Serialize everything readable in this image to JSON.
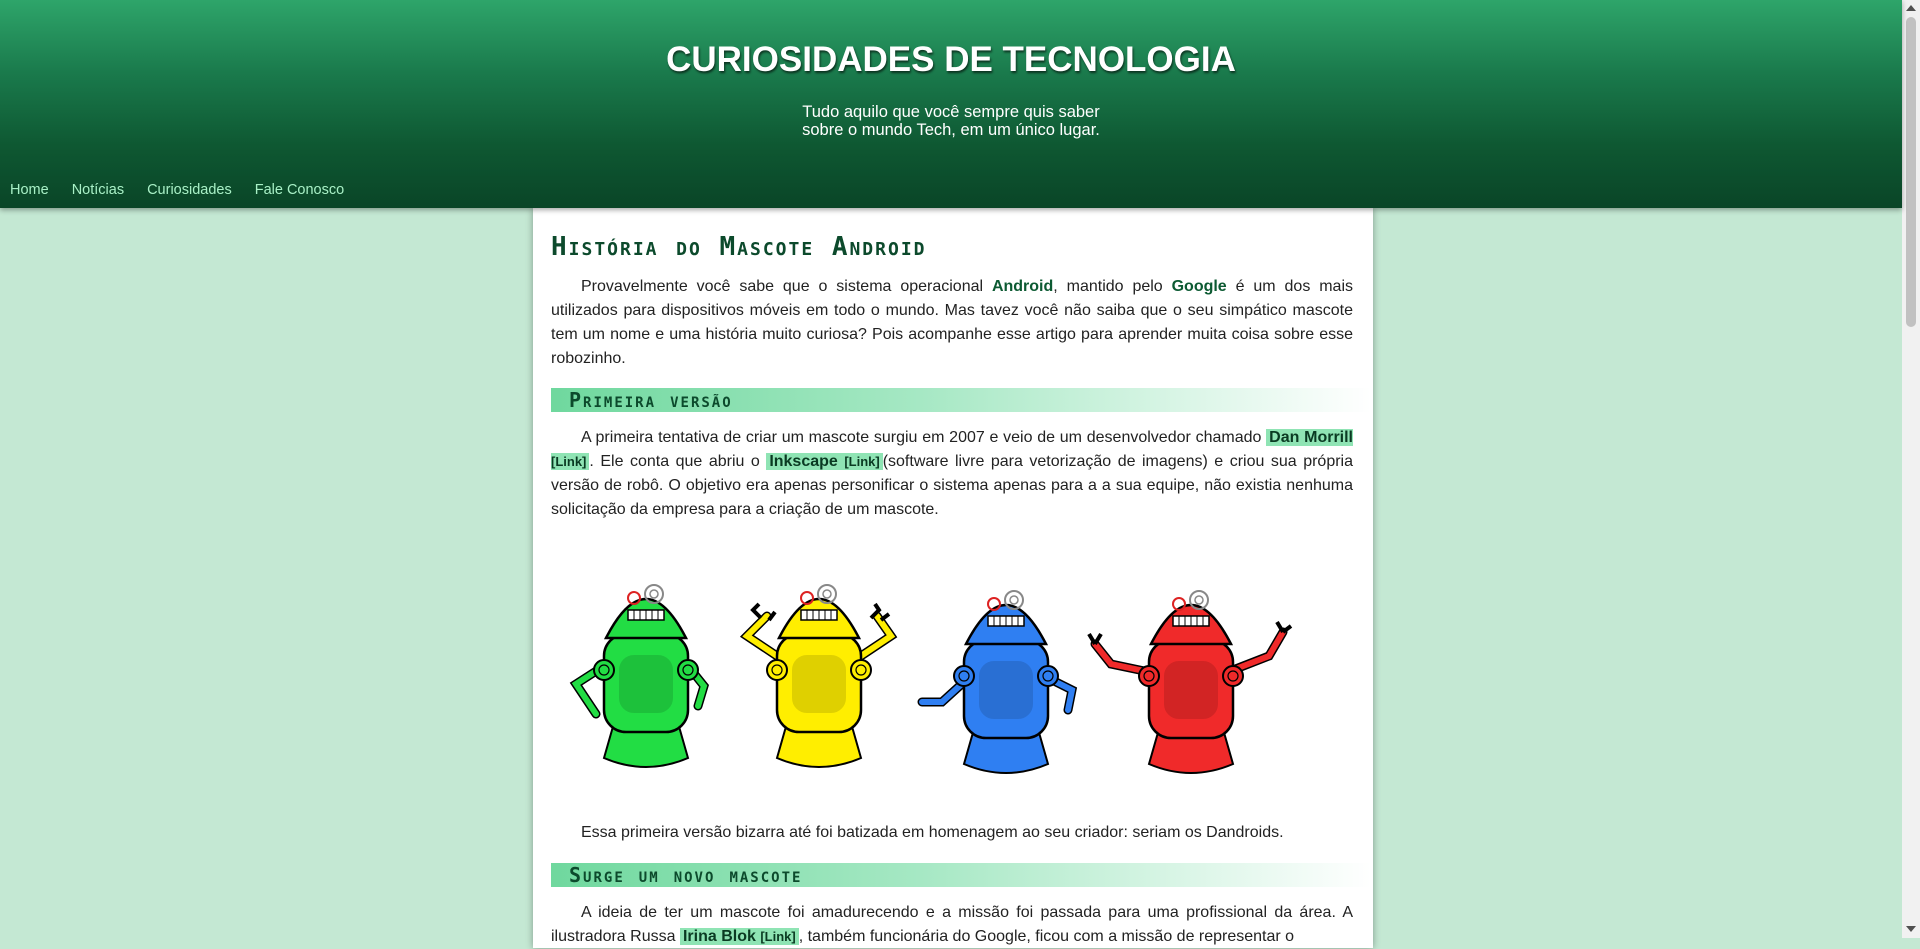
{
  "header": {
    "title": "CURIOSIDADES DE TECNOLOGIA",
    "subtitle_line1": "Tudo aquilo que você sempre quis saber",
    "subtitle_line2": "sobre o mundo Tech, em um único lugar."
  },
  "nav": {
    "items": [
      {
        "label": "Home"
      },
      {
        "label": "Notícias"
      },
      {
        "label": "Curiosidades"
      },
      {
        "label": "Fale Conosco"
      }
    ]
  },
  "article": {
    "title": "História do Mascote Android",
    "intro": {
      "t1": "Provavelmente você sabe que o sistema operacional ",
      "k1": "Android",
      "t2": ", mantido pelo ",
      "k2": "Google",
      "t3": " é um dos mais utilizados para dispositivos móveis em todo o mundo. Mas tavez você não saiba que o seu simpático mascote tem um nome e uma história muito curiosa? Pois acompanhe esse artigo para aprender muita coisa sobre esse robozinho."
    },
    "section1": {
      "heading": "Primeira versão",
      "p1": {
        "t1": "A primeira tentativa de criar um mascote surgiu em 2007 e veio de um desenvolvedor chamado ",
        "link1_name": "Dan Morrill",
        "link1_tag": "[Link]",
        "t2": ". Ele conta que abriu o ",
        "link2_name": "Inkscape",
        "link2_tag": "[Link]",
        "t3": "(software livre para vetorização de imagens) e criou sua própria versão de robô. O objetivo era apenas personificar o sistema apenas para a a sua equipe, não existia nenhuma solicitação da empresa para a criação de um mascote."
      },
      "image": {
        "robots": [
          "green-robot",
          "yellow-robot",
          "blue-robot",
          "red-robot"
        ]
      },
      "p2": "Essa primeira versão bizarra até foi batizada em homenagem ao seu criador: seriam os Dandroids."
    },
    "section2": {
      "heading": "Surge um novo mascote",
      "p1": {
        "t1": "A ideia de ter um mascote foi amadurecendo e a missão foi passada para uma profissional da área. A ilustradora Russa ",
        "link1_name": "Irina Blok",
        "link1_tag": "[Link]",
        "t2": ", também funcionária do Google, ficou com a missão de representar o"
      }
    }
  },
  "colors": {
    "page_bg": "#c4e8d3",
    "header_dark": "#0a4527",
    "header_light": "#2ea56a",
    "nav_link": "#a8f0c6",
    "highlight": "#8fe4b4",
    "robot_green": "#22dd44",
    "robot_yellow": "#ffee00",
    "robot_blue": "#2f7ff2",
    "robot_red": "#f02a2a"
  }
}
